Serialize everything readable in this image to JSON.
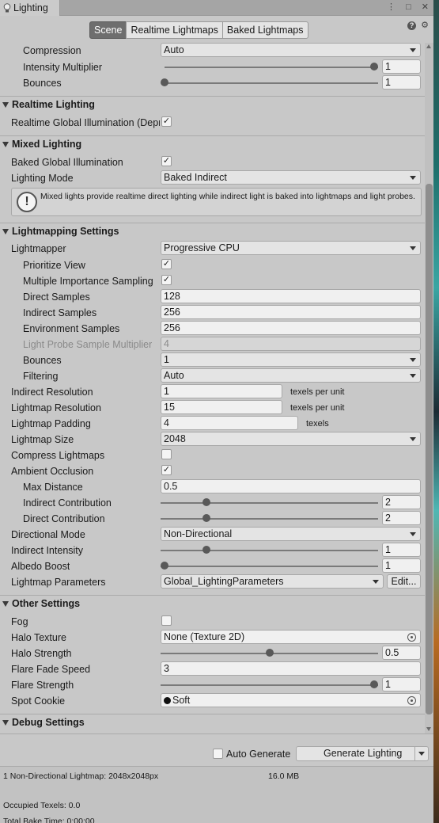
{
  "window": {
    "tab_title": "Lighting",
    "icons": [
      "more-icon",
      "maximize-icon",
      "close-icon"
    ]
  },
  "modes": [
    {
      "label": "Scene",
      "active": true
    },
    {
      "label": "Realtime Lightmaps",
      "active": false
    },
    {
      "label": "Baked Lightmaps",
      "active": false
    }
  ],
  "top": {
    "compression_label": "Compression",
    "compression_value": "Auto",
    "intensity_label": "Intensity Multiplier",
    "intensity_value": "1",
    "bounces_label": "Bounces",
    "bounces_value": "1"
  },
  "realtime": {
    "title": "Realtime Lighting",
    "gi_label": "Realtime Global Illumination (Deprecated)",
    "gi_checked": true
  },
  "mixed": {
    "title": "Mixed Lighting",
    "baked_gi_label": "Baked Global Illumination",
    "baked_gi_checked": true,
    "mode_label": "Lighting Mode",
    "mode_value": "Baked Indirect",
    "help": "Mixed lights provide realtime direct lighting while indirect light is baked into lightmaps and light probes."
  },
  "lightmapping": {
    "title": "Lightmapping Settings",
    "lightmapper_label": "Lightmapper",
    "lightmapper_value": "Progressive CPU",
    "prioritize_label": "Prioritize View",
    "prioritize_checked": true,
    "mis_label": "Multiple Importance Sampling",
    "mis_checked": true,
    "direct_samples_label": "Direct Samples",
    "direct_samples_value": "128",
    "indirect_samples_label": "Indirect Samples",
    "indirect_samples_value": "256",
    "env_samples_label": "Environment Samples",
    "env_samples_value": "256",
    "probe_mult_label": "Light Probe Sample Multiplier",
    "probe_mult_value": "4",
    "bounces_label": "Bounces",
    "bounces_value": "1",
    "filtering_label": "Filtering",
    "filtering_value": "Auto",
    "indirect_res_label": "Indirect Resolution",
    "indirect_res_value": "1",
    "indirect_res_unit": "texels per unit",
    "lightmap_res_label": "Lightmap Resolution",
    "lightmap_res_value": "15",
    "lightmap_res_unit": "texels per unit",
    "padding_label": "Lightmap Padding",
    "padding_value": "4",
    "padding_unit": "texels",
    "size_label": "Lightmap Size",
    "size_value": "2048",
    "compress_label": "Compress Lightmaps",
    "compress_checked": false,
    "ao_label": "Ambient Occlusion",
    "ao_checked": true,
    "max_dist_label": "Max Distance",
    "max_dist_value": "0.5",
    "indirect_contrib_label": "Indirect Contribution",
    "indirect_contrib_value": "2",
    "indirect_contrib_level": 0.2,
    "direct_contrib_label": "Direct Contribution",
    "direct_contrib_value": "2",
    "direct_contrib_level": 0.2,
    "directional_label": "Directional Mode",
    "directional_value": "Non-Directional",
    "indirect_int_label": "Indirect Intensity",
    "indirect_int_value": "1",
    "indirect_int_level": 0.2,
    "albedo_label": "Albedo Boost",
    "albedo_value": "1",
    "albedo_level": 0.0,
    "params_label": "Lightmap Parameters",
    "params_value": "Global_LightingParameters",
    "edit_label": "Edit..."
  },
  "other": {
    "title": "Other Settings",
    "fog_label": "Fog",
    "fog_checked": false,
    "halo_tex_label": "Halo Texture",
    "halo_tex_value": "None (Texture 2D)",
    "halo_strength_label": "Halo Strength",
    "halo_strength_value": "0.5",
    "halo_strength_level": 0.5,
    "flare_fade_label": "Flare Fade Speed",
    "flare_fade_value": "3",
    "flare_strength_label": "Flare Strength",
    "flare_strength_value": "1",
    "flare_strength_level": 1.0,
    "spot_cookie_label": "Spot Cookie",
    "spot_cookie_value": "Soft"
  },
  "debug": {
    "title": "Debug Settings"
  },
  "bottom": {
    "auto_generate_label": "Auto Generate",
    "auto_generate_checked": false,
    "generate_label": "Generate Lighting",
    "stats_lightmaps": "1 Non-Directional Lightmap: 2048x2048px",
    "stats_size": "16.0 MB",
    "stats_texels": "Occupied Texels: 0.0",
    "stats_time": "Total Bake Time: 0:00:00"
  },
  "colors": {
    "panel": "#c8c8c8",
    "active_tab": "#6e6e6e",
    "field": "#f0f0f0"
  }
}
